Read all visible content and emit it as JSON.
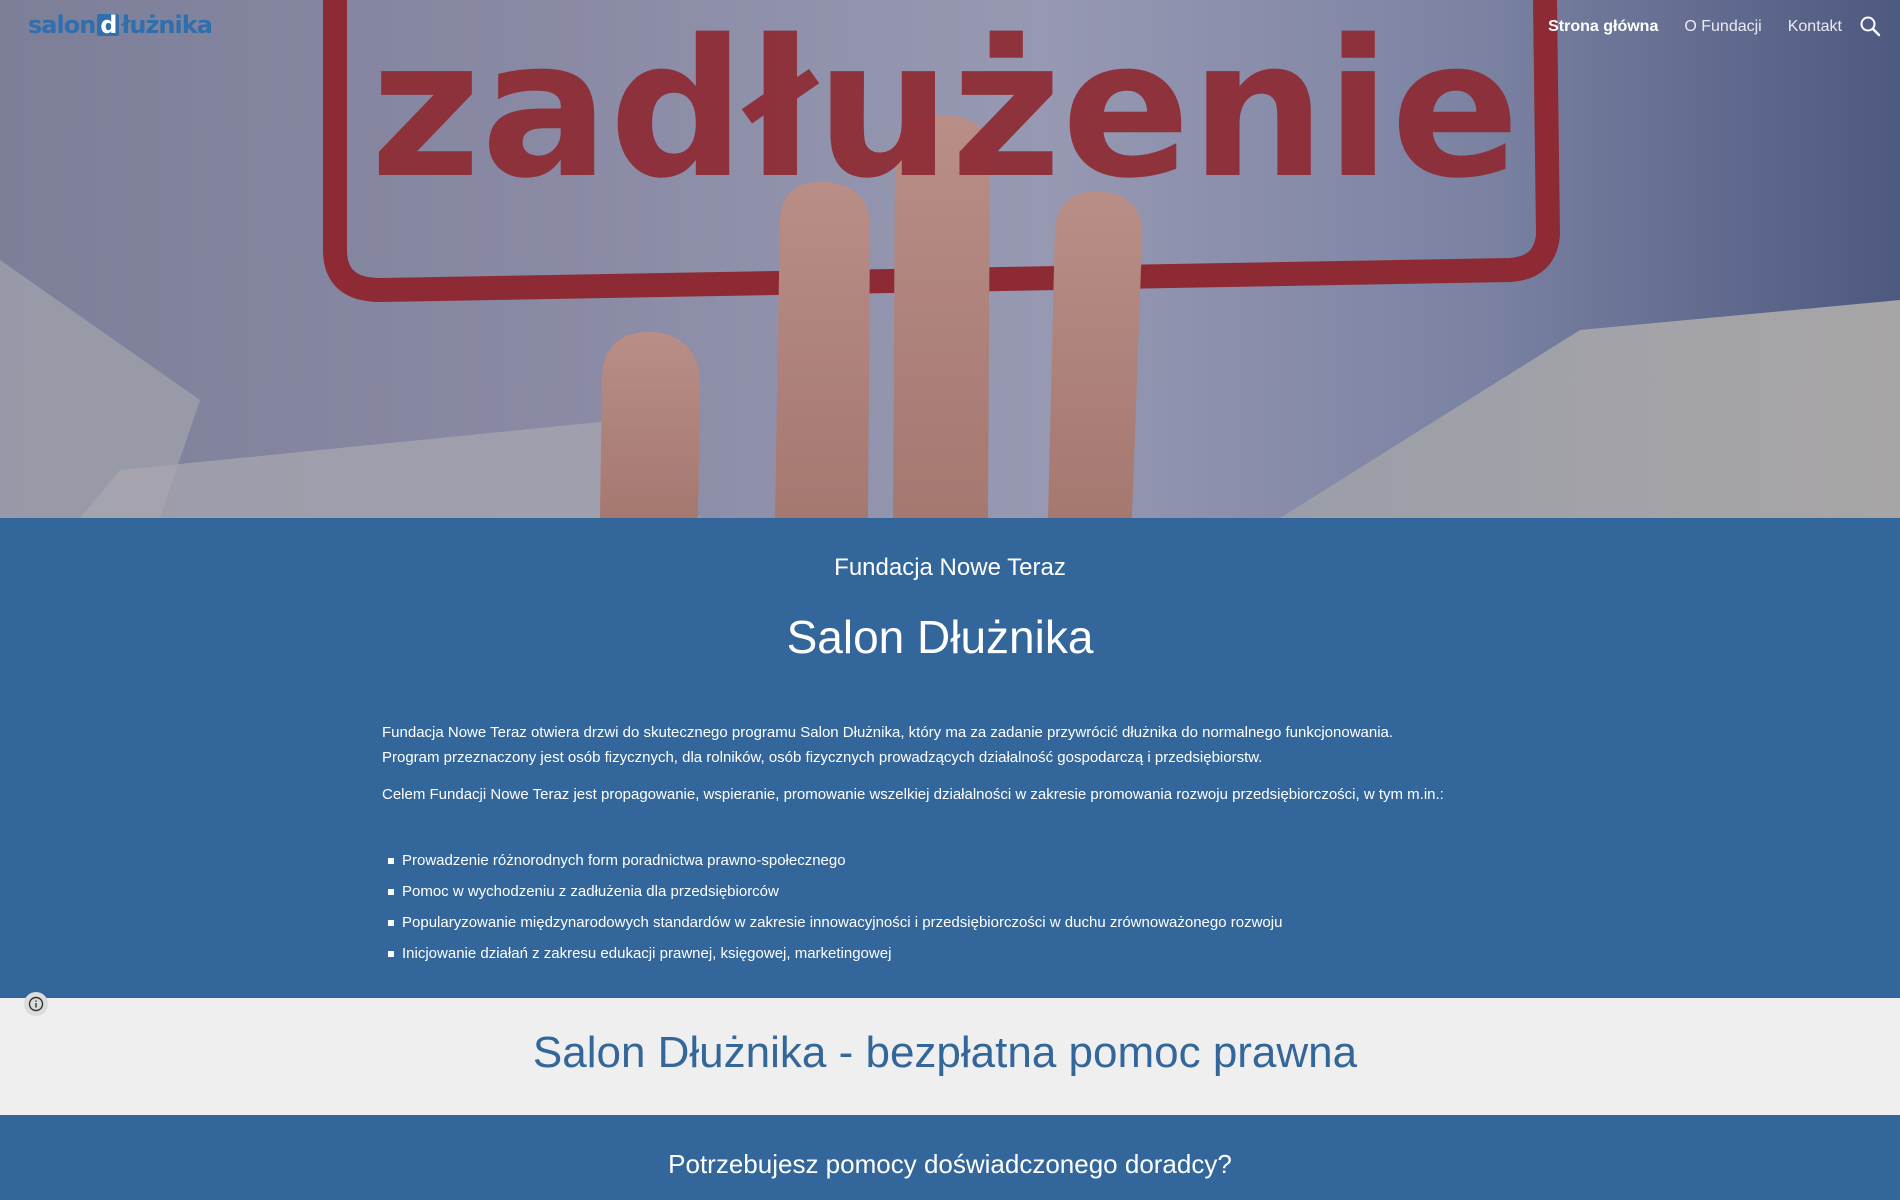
{
  "header": {
    "logo_text_1": "salon",
    "logo_letter": "d",
    "logo_text_2": "łużnika",
    "nav": [
      "Strona główna",
      "O Fundacji",
      "Kontakt"
    ],
    "search_icon": "search-icon"
  },
  "hero": {
    "word": "zadłużenie"
  },
  "intro": {
    "subtitle": "Fundacja Nowe Teraz",
    "title": "Salon Dłużnika",
    "paragraph_1": "Fundacja Nowe Teraz otwiera drzwi do skutecznego programu Salon Dłużnika, który ma za zadanie przywrócić dłużnika do normalnego funkcjonowania. Program przeznaczony jest osób fizycznych, dla rolników, osób fizycznych prowadzących działalność gospodarczą i przedsiębiorstw.",
    "paragraph_2": "Celem Fundacji Nowe Teraz jest propagowanie, wspieranie, promowanie wszelkiej działalności w zakresie promowania rozwoju przedsiębiorczości, w tym m.in.:",
    "list": [
      "Prowadzenie różnorodnych form poradnictwa prawno-społecznego",
      "Pomoc w wychodzeniu z zadłużenia dla przedsiębiorców",
      "Popularyzowanie międzynarodowych standardów w zakresie innowacyjności i przedsiębiorczości w duchu zrównoważonego rozwoju",
      "Inicjowanie działań z zakresu edukacji prawnej, księgowej, marketingowej"
    ]
  },
  "band": {
    "heading": "Salon Dłużnika - bezpłatna pomoc prawna"
  },
  "bottom": {
    "heading": "Potrzebujesz pomocy doświadczonego doradcy?"
  },
  "colors": {
    "blue": "#33669a",
    "light": "#efefef",
    "red_stamp": "#8e2a33"
  }
}
